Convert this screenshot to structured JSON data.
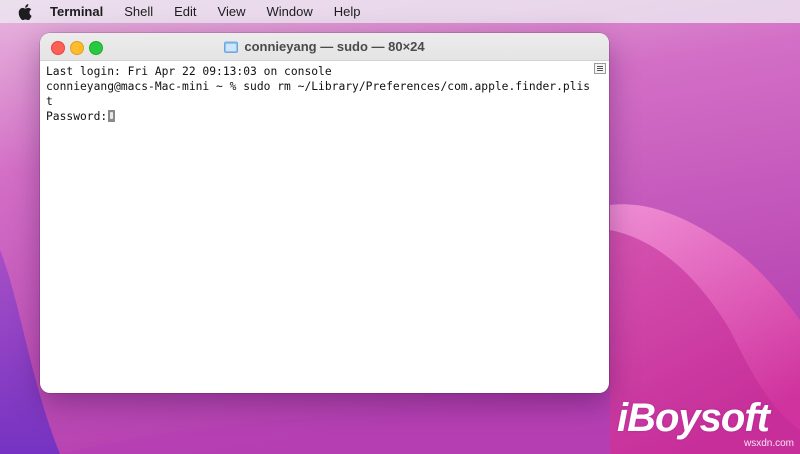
{
  "menubar": {
    "app_name": "Terminal",
    "items": [
      "Shell",
      "Edit",
      "View",
      "Window",
      "Help"
    ]
  },
  "window": {
    "title": "connieyang — sudo — 80×24"
  },
  "terminal": {
    "lines": [
      "Last login: Fri Apr 22 09:13:03 on console",
      "connieyang@macs-Mac-mini ~ % sudo rm ~/Library/Preferences/com.apple.finder.plis",
      "t"
    ],
    "prompt": "Password:"
  },
  "watermark": {
    "brand": "iBoysoft",
    "site": "wsxdn.com"
  },
  "colors": {
    "close": "#fe5f57",
    "minimize": "#febc2e",
    "maximize": "#28c840",
    "wallpaper_primary": "#c94fb6"
  }
}
